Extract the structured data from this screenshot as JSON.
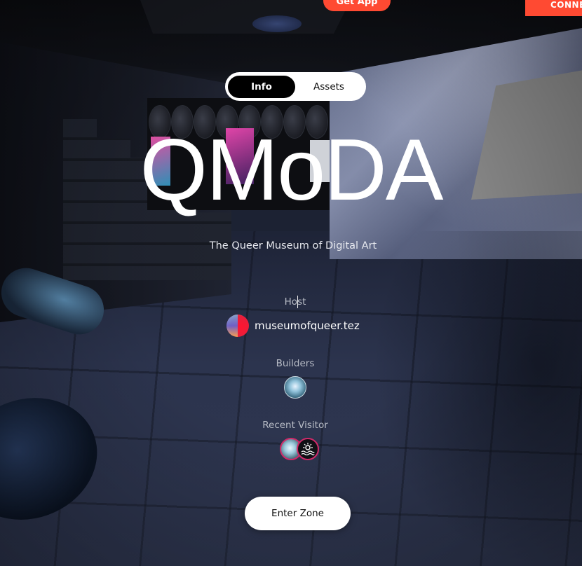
{
  "header": {
    "get_app_label": "Get App",
    "connect_label": "CONNECT"
  },
  "tabs": [
    {
      "label": "Info",
      "active": true
    },
    {
      "label": "Assets",
      "active": false
    }
  ],
  "zone": {
    "title": "QMoDA",
    "subtitle": "The Queer Museum of Digital Art"
  },
  "host": {
    "label": "Host",
    "name": "museumofqueer.tez"
  },
  "builders": {
    "label": "Builders"
  },
  "visitors": {
    "label": "Recent Visitor"
  },
  "enter_label": "Enter Zone",
  "colors": {
    "accent": "#ff4a32",
    "visitor_ring": "#d02a6a"
  }
}
